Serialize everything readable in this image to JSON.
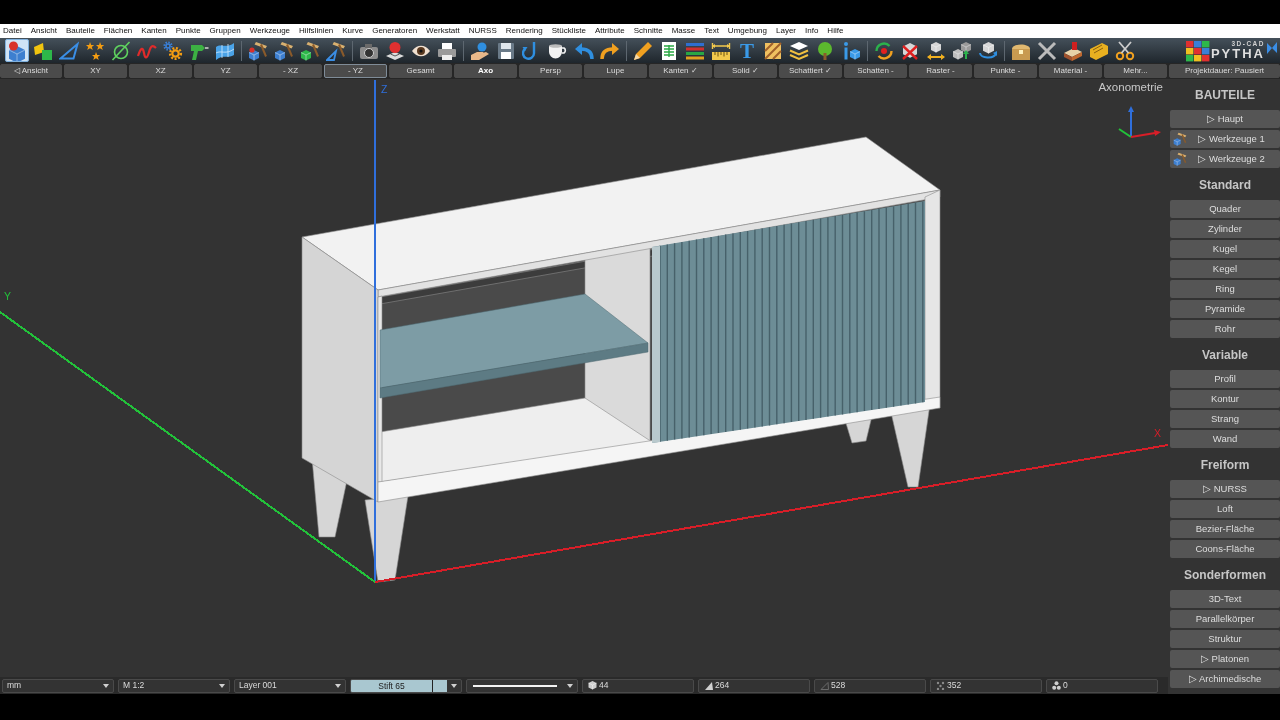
{
  "menu": [
    "Datei",
    "Ansicht",
    "Bauteile",
    "Flächen",
    "Kanten",
    "Punkte",
    "Gruppen",
    "Werkzeuge",
    "Hilfslinien",
    "Kurve",
    "Generatoren",
    "Werkstatt",
    "NURSS",
    "Rendering",
    "Stückliste",
    "Attribute",
    "Schnitte",
    "Masse",
    "Text",
    "Umgebung",
    "Layer",
    "Info",
    "Hilfe"
  ],
  "toolbar": {
    "groups": [
      [
        {
          "kind": "icon",
          "selected": true
        },
        {
          "kind": "icon",
          "selected": false
        },
        {
          "kind": "icon",
          "selected": false
        },
        {
          "kind": "icon",
          "selected": false
        },
        {
          "kind": "icon",
          "selected": false
        },
        {
          "kind": "icon",
          "selected": false
        },
        {
          "kind": "icon",
          "selected": false
        },
        {
          "kind": "icon",
          "selected": false
        },
        {
          "kind": "icon",
          "selected": false
        }
      ],
      [
        {
          "kind": "icon",
          "selected": false
        },
        {
          "kind": "icon",
          "selected": false
        },
        {
          "kind": "icon",
          "selected": false
        },
        {
          "kind": "icon",
          "selected": false
        }
      ],
      [
        {
          "kind": "icon",
          "selected": false
        },
        {
          "kind": "icon",
          "selected": false
        },
        {
          "kind": "icon",
          "selected": false
        },
        {
          "kind": "icon",
          "selected": false
        }
      ],
      [
        {
          "kind": "icon",
          "selected": false
        },
        {
          "kind": "icon",
          "selected": false
        },
        {
          "kind": "icon",
          "selected": false
        },
        {
          "kind": "icon",
          "selected": false
        },
        {
          "kind": "icon",
          "selected": false
        },
        {
          "kind": "icon",
          "selected": false
        }
      ],
      [
        {
          "kind": "icon",
          "selected": false
        },
        {
          "kind": "icon",
          "selected": false
        },
        {
          "kind": "icon",
          "selected": false
        },
        {
          "kind": "icon",
          "selected": false
        },
        {
          "kind": "glyph",
          "label": "T",
          "selected": false
        },
        {
          "kind": "icon",
          "selected": false
        },
        {
          "kind": "icon",
          "selected": false
        },
        {
          "kind": "icon",
          "selected": false
        },
        {
          "kind": "icon",
          "selected": false
        }
      ],
      [
        {
          "kind": "icon",
          "selected": false
        },
        {
          "kind": "icon",
          "selected": false
        },
        {
          "kind": "icon",
          "selected": false
        },
        {
          "kind": "icon",
          "selected": false
        },
        {
          "kind": "icon",
          "selected": false
        }
      ],
      [
        {
          "kind": "icon",
          "selected": false
        },
        {
          "kind": "icon",
          "selected": false
        },
        {
          "kind": "icon",
          "selected": false
        },
        {
          "kind": "icon",
          "selected": false
        },
        {
          "kind": "icon",
          "selected": false
        }
      ]
    ],
    "logo": {
      "tagline": "3D-CAD",
      "wordmark": "PYTHA"
    }
  },
  "view_bar": [
    {
      "label": "◁ Ansicht",
      "selected": false,
      "focused": false
    },
    {
      "label": "XY",
      "selected": false,
      "focused": false
    },
    {
      "label": "XZ",
      "selected": false,
      "focused": false
    },
    {
      "label": "YZ",
      "selected": false,
      "focused": false
    },
    {
      "label": "- XZ",
      "selected": false,
      "focused": false
    },
    {
      "label": "- YZ",
      "selected": false,
      "focused": true
    },
    {
      "label": "Gesamt",
      "selected": false,
      "focused": false
    },
    {
      "label": "Axo",
      "selected": true,
      "focused": false
    },
    {
      "label": "Persp",
      "selected": false,
      "focused": false
    },
    {
      "label": "Lupe",
      "selected": false,
      "focused": false
    },
    {
      "label": "Kanten ✓",
      "selected": false,
      "focused": false
    },
    {
      "label": "Solid ✓",
      "selected": false,
      "focused": false
    },
    {
      "label": "Schattiert ✓",
      "selected": false,
      "focused": false
    },
    {
      "label": "Schatten -",
      "selected": false,
      "focused": false
    },
    {
      "label": "Raster -",
      "selected": false,
      "focused": false
    },
    {
      "label": "Punkte -",
      "selected": false,
      "focused": false
    },
    {
      "label": "Material -",
      "selected": false,
      "focused": false
    },
    {
      "label": "Mehr...",
      "selected": false,
      "focused": false
    },
    {
      "label": "Projektdauer: Pausiert",
      "selected": false,
      "focused": false
    }
  ],
  "viewport": {
    "projection_label": "Axonometrie",
    "axes": [
      {
        "label": "Z",
        "color": "#2f6fdc"
      },
      {
        "label": "Y",
        "color": "#22c23a"
      },
      {
        "label": "X",
        "color": "#d81e28"
      }
    ]
  },
  "side_panel": {
    "sections": [
      {
        "title": "BAUTEILE",
        "items": [
          {
            "label": "▷ Haupt",
            "kind": "plain"
          },
          {
            "label": "▷ Werkzeuge 1",
            "kind": "tool"
          },
          {
            "label": "▷ Werkzeuge 2",
            "kind": "tool"
          }
        ]
      },
      {
        "title": "Standard",
        "items": [
          {
            "label": "Quader"
          },
          {
            "label": "Zylinder"
          },
          {
            "label": "Kugel"
          },
          {
            "label": "Kegel"
          },
          {
            "label": "Ring"
          },
          {
            "label": "Pyramide"
          },
          {
            "label": "Rohr"
          }
        ]
      },
      {
        "title": "Variable",
        "items": [
          {
            "label": "Profil"
          },
          {
            "label": "Kontur"
          },
          {
            "label": "Strang"
          },
          {
            "label": "Wand"
          }
        ]
      },
      {
        "title": "Freiform",
        "items": [
          {
            "label": "▷ NURSS"
          },
          {
            "label": "Loft"
          },
          {
            "label": "Bezier-Fläche"
          },
          {
            "label": "Coons-Fläche"
          }
        ]
      },
      {
        "title": "Sonderformen",
        "items": [
          {
            "label": "3D-Text"
          },
          {
            "label": "Parallelkörper"
          },
          {
            "label": "Struktur"
          },
          {
            "label": "▷ Platonen"
          },
          {
            "label": "▷ Archimedische"
          }
        ]
      }
    ]
  },
  "status_bar": {
    "fields": [
      {
        "kind": "select",
        "value": "mm"
      },
      {
        "kind": "select",
        "value": "M 1:2"
      },
      {
        "kind": "select",
        "value": "Layer 001"
      },
      {
        "kind": "pen",
        "value": "Stift 65",
        "color": "#a9c7d0"
      },
      {
        "kind": "line"
      },
      {
        "kind": "count",
        "value": "44"
      },
      {
        "kind": "count",
        "value": "264"
      },
      {
        "kind": "count",
        "value": "528"
      },
      {
        "kind": "count",
        "value": "352"
      },
      {
        "kind": "count",
        "value": "0"
      }
    ]
  }
}
